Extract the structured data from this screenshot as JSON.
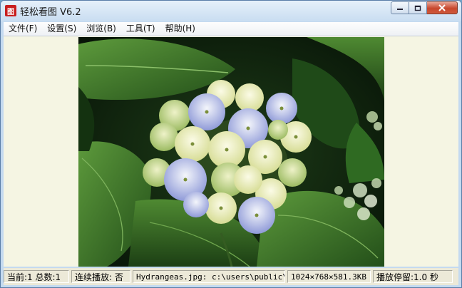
{
  "window": {
    "title": "轻松看图 V6.2",
    "icon_name": "app-icon"
  },
  "menu": [
    {
      "label": "文件(F)"
    },
    {
      "label": "设置(S)"
    },
    {
      "label": "浏览(B)"
    },
    {
      "label": "工具(T)"
    },
    {
      "label": "帮助(H)"
    }
  ],
  "status": {
    "index": "当前:1 总数:1",
    "slideshow": "连续播放: 否",
    "file": "Hydrangeas.jpg: c:\\users\\public\\pi",
    "size": "1024×768×581.3KB",
    "delay": "播放停留:1.0 秒"
  },
  "colors": {
    "client_bg": "#f5f5e3",
    "status_bg": "#ece9d8",
    "close_button": "#c7472d"
  }
}
